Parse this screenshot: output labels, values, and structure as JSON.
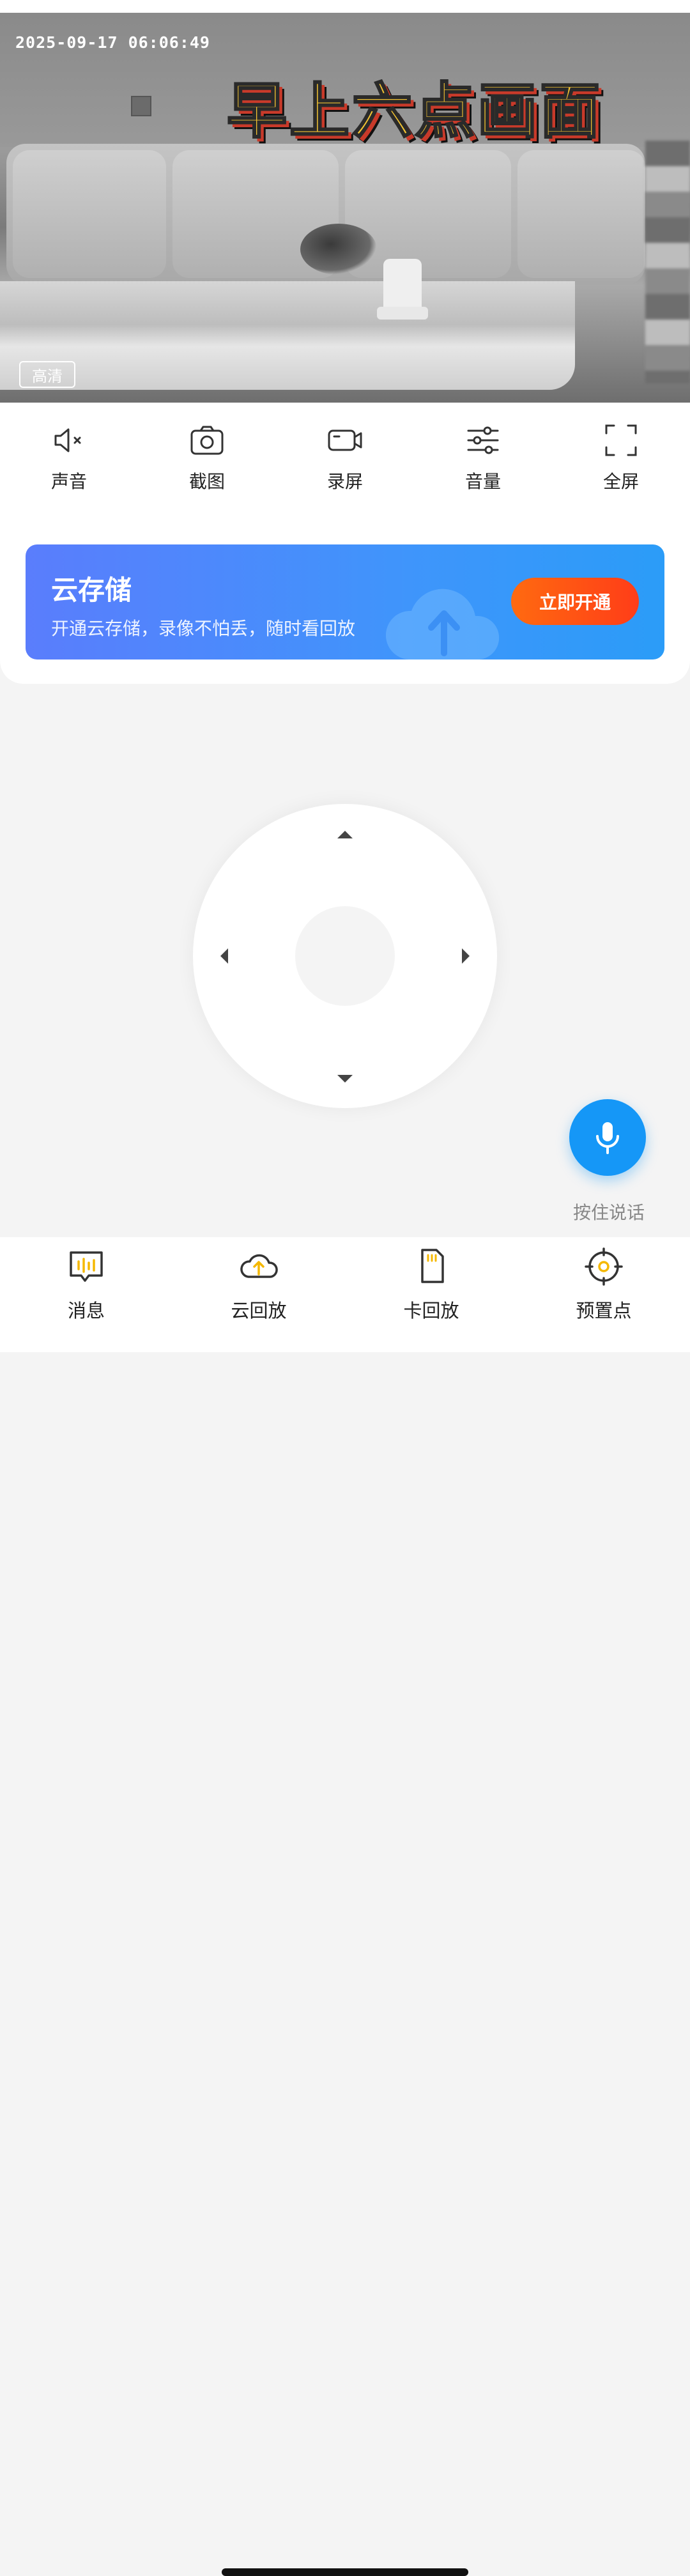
{
  "video": {
    "timestamp": "2025-09-17  06:06:49",
    "overlay_caption": "早上六点画面",
    "quality_badge": "高清"
  },
  "toolbar": {
    "items": [
      {
        "label": "声音",
        "icon": "speaker-muted-icon"
      },
      {
        "label": "截图",
        "icon": "camera-icon"
      },
      {
        "label": "录屏",
        "icon": "video-record-icon"
      },
      {
        "label": "音量",
        "icon": "sliders-icon"
      },
      {
        "label": "全屏",
        "icon": "fullscreen-icon"
      }
    ]
  },
  "cloud_storage": {
    "title": "云存储",
    "subtitle": "开通云存储，录像不怕丢，随时看回放",
    "button_label": "立即开通"
  },
  "talk": {
    "label": "按住说话",
    "icon": "microphone-icon"
  },
  "bottom_nav": {
    "items": [
      {
        "label": "消息",
        "icon": "message-icon"
      },
      {
        "label": "云回放",
        "icon": "cloud-upload-icon"
      },
      {
        "label": "卡回放",
        "icon": "sd-card-icon"
      },
      {
        "label": "预置点",
        "icon": "target-icon"
      }
    ]
  },
  "colors": {
    "accent_blue": "#1597f7",
    "banner_start": "#5a7dfc",
    "banner_end": "#2b9cf8",
    "cta_orange": "#ff4a14",
    "nav_icon_yellow": "#f5b800"
  }
}
